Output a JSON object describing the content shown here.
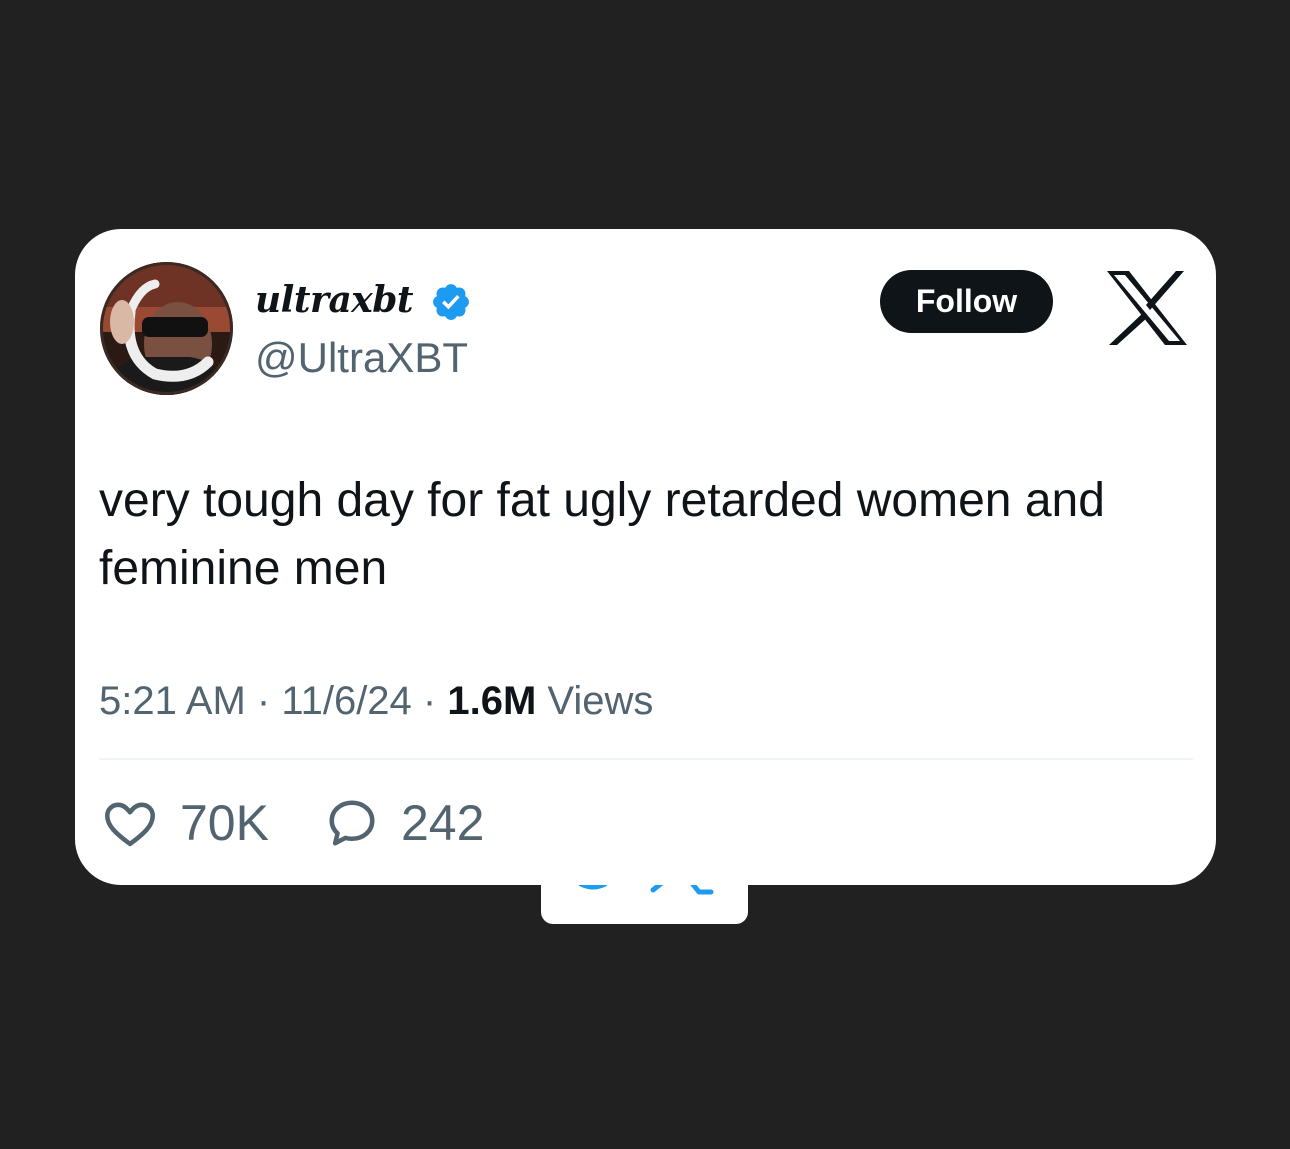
{
  "user": {
    "display_name": "ultraxbt",
    "handle": "@UltraXBT",
    "verified_icon": "verified-badge-icon"
  },
  "header": {
    "follow_label": "Follow",
    "brand_icon": "x-logo-icon"
  },
  "tweet": {
    "text": "very tough day for fat ugly retarded women and feminine men",
    "time": "5:21 AM",
    "sep1": " · ",
    "date": "11/6/24",
    "sep2": " · ",
    "views_count": "1.6M",
    "views_label": " Views"
  },
  "actions": {
    "likes": "70K",
    "replies": "242",
    "like_icon": "heart-icon",
    "reply_icon": "speech-bubble-icon"
  },
  "colors": {
    "page_background": "#212121",
    "card_background": "#ffffff",
    "text_primary": "#0f1419",
    "text_secondary": "#536471",
    "verified_blue": "#1d9bf0"
  }
}
